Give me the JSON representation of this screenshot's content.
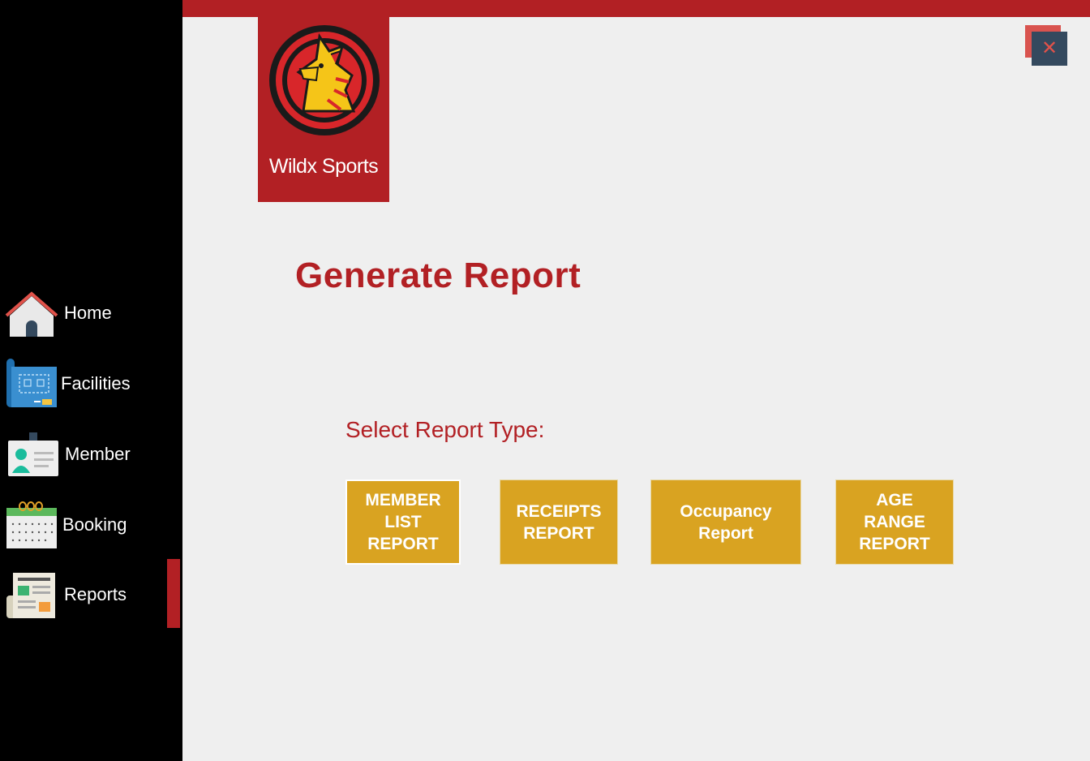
{
  "brand": {
    "name": "Wildx Sports"
  },
  "sidebar": {
    "items": [
      {
        "label": "Home",
        "icon": "home-icon"
      },
      {
        "label": "Facilities",
        "icon": "blueprint-icon"
      },
      {
        "label": "Member",
        "icon": "id-card-icon"
      },
      {
        "label": "Booking",
        "icon": "calendar-icon"
      },
      {
        "label": "Reports",
        "icon": "newspaper-icon"
      }
    ],
    "active": "Reports"
  },
  "window": {
    "close_label": "✕"
  },
  "main": {
    "title": "Generate Report",
    "select_label": "Select Report Type:",
    "buttons": [
      {
        "label": "MEMBER\nLIST\nREPORT"
      },
      {
        "label": "RECEIPTS\nREPORT"
      },
      {
        "label": "Occupancy\nReport"
      },
      {
        "label": "AGE\nRANGE\nREPORT"
      }
    ]
  },
  "colors": {
    "accent": "#b22024",
    "button": "#d9a321",
    "sidebar": "#000000",
    "background": "#efefef",
    "close_button": "#34495e"
  }
}
